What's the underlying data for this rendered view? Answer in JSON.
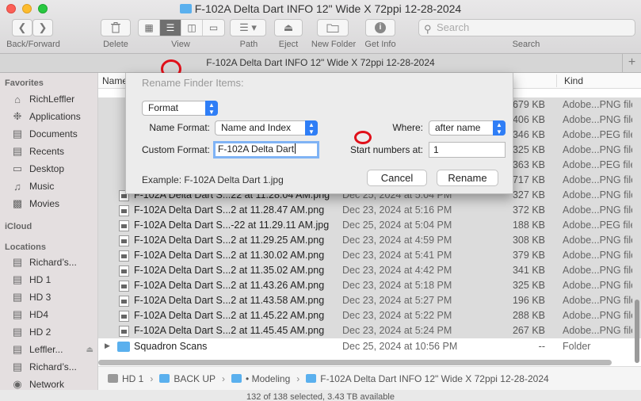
{
  "window": {
    "title": "F-102A Delta Dart INFO 12\" Wide X 72ppi 12-28-2024"
  },
  "toolbar": {
    "back_forward_label": "Back/Forward",
    "delete_label": "Delete",
    "view_label": "View",
    "path_label": "Path",
    "eject_label": "Eject",
    "new_folder_label": "New Folder",
    "get_info_label": "Get Info",
    "search_label": "Search",
    "search_placeholder": "Search"
  },
  "tab": {
    "title": "F-102A Delta Dart INFO 12\" Wide X 72ppi 12-28-2024",
    "plus": "+"
  },
  "sidebar": {
    "favorites_heading": "Favorites",
    "favorites": [
      {
        "label": "RichLeffler",
        "icon": "home-icon"
      },
      {
        "label": "Applications",
        "icon": "applications-icon"
      },
      {
        "label": "Documents",
        "icon": "document-icon"
      },
      {
        "label": "Recents",
        "icon": "clock-icon"
      },
      {
        "label": "Desktop",
        "icon": "desktop-icon"
      },
      {
        "label": "Music",
        "icon": "music-icon"
      },
      {
        "label": "Movies",
        "icon": "film-icon"
      }
    ],
    "icloud_heading": "iCloud",
    "locations_heading": "Locations",
    "locations": [
      {
        "label": "Richard’s...",
        "icon": "computer-icon"
      },
      {
        "label": "HD 1",
        "icon": "disk-icon"
      },
      {
        "label": "HD 3",
        "icon": "disk-icon"
      },
      {
        "label": "HD4",
        "icon": "disk-icon"
      },
      {
        "label": "HD 2",
        "icon": "disk-icon"
      },
      {
        "label": "Leffler...",
        "icon": "disk-icon"
      },
      {
        "label": "Richard’s...",
        "icon": "disk-icon"
      },
      {
        "label": "Network",
        "icon": "network-icon"
      }
    ]
  },
  "list": {
    "columns": {
      "name": "Name",
      "kind": "Kind"
    },
    "partial_rows": [
      {
        "size": "679 KB",
        "kind": "Adobe...PNG file"
      },
      {
        "size": "406 KB",
        "kind": "Adobe...PNG file"
      },
      {
        "size": "346 KB",
        "kind": "Adobe...PEG file"
      },
      {
        "size": "325 KB",
        "kind": "Adobe...PNG file"
      },
      {
        "size": "363 KB",
        "kind": "Adobe...PEG file"
      },
      {
        "size": "717 KB",
        "kind": "Adobe...PNG file"
      }
    ],
    "rows": [
      {
        "name": "F-102A Delta Dart S...22 at 11.28.04 AM.png",
        "date": "Dec 25, 2024 at 5:04 PM",
        "size": "327 KB",
        "kind": "Adobe...PNG file"
      },
      {
        "name": "F-102A Delta Dart S...2 at 11.28.47 AM.png",
        "date": "Dec 23, 2024 at 5:16 PM",
        "size": "372 KB",
        "kind": "Adobe...PNG file"
      },
      {
        "name": "F-102A Delta Dart S...-22 at 11.29.11 AM.jpg",
        "date": "Dec 25, 2024 at 5:04 PM",
        "size": "188 KB",
        "kind": "Adobe...PEG file"
      },
      {
        "name": "F-102A Delta Dart S...2 at 11.29.25 AM.png",
        "date": "Dec 23, 2024 at 4:59 PM",
        "size": "308 KB",
        "kind": "Adobe...PNG file"
      },
      {
        "name": "F-102A Delta Dart S...2 at 11.30.02 AM.png",
        "date": "Dec 23, 2024 at 5:41 PM",
        "size": "379 KB",
        "kind": "Adobe...PNG file"
      },
      {
        "name": "F-102A Delta Dart S...2 at 11.35.02 AM.png",
        "date": "Dec 23, 2024 at 4:42 PM",
        "size": "341 KB",
        "kind": "Adobe...PNG file"
      },
      {
        "name": "F-102A Delta Dart S...2 at 11.43.26 AM.png",
        "date": "Dec 23, 2024 at 5:18 PM",
        "size": "325 KB",
        "kind": "Adobe...PNG file"
      },
      {
        "name": "F-102A Delta Dart S...2 at 11.43.58 AM.png",
        "date": "Dec 23, 2024 at 5:27 PM",
        "size": "196 KB",
        "kind": "Adobe...PNG file"
      },
      {
        "name": "F-102A Delta Dart S...2 at 11.45.22 AM.png",
        "date": "Dec 23, 2024 at 5:22 PM",
        "size": "288 KB",
        "kind": "Adobe...PNG file"
      },
      {
        "name": "F-102A Delta Dart S...2 at 11.45.45 AM.png",
        "date": "Dec 23, 2024 at 5:24 PM",
        "size": "267 KB",
        "kind": "Adobe...PNG file"
      }
    ],
    "folder_row": {
      "name": "Squadron Scans",
      "date": "Dec 25, 2024 at 10:56 PM",
      "size": "--",
      "kind": "Folder"
    }
  },
  "pathbar": {
    "crumbs": [
      "HD 1",
      "BACK UP",
      "• Modeling",
      "F-102A Delta Dart INFO 12\" Wide X 72ppi 12-28-2024"
    ]
  },
  "status": {
    "text": "132 of 138 selected, 3.43 TB available"
  },
  "rename_sheet": {
    "title": "Rename Finder Items:",
    "mode": "Format",
    "name_format_label": "Name Format:",
    "name_format_value": "Name and Index",
    "where_label": "Where:",
    "where_value": "after name",
    "custom_format_label": "Custom Format:",
    "custom_format_value": "F-102A Delta Dart",
    "start_numbers_label": "Start numbers at:",
    "start_numbers_value": "1",
    "example": "Example: F-102A Delta Dart 1.jpg",
    "cancel_label": "Cancel",
    "rename_label": "Rename"
  },
  "colors": {
    "accent": "#2f7ef6",
    "annotation_ring": "#e0101a",
    "folder": "#5ab0ee",
    "selection": "#dcdcdc"
  }
}
